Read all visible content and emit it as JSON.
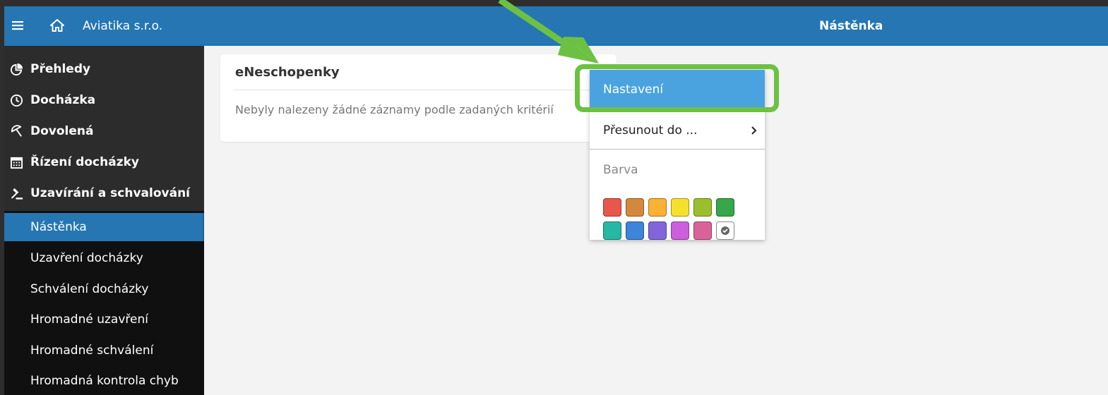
{
  "header": {
    "company": "Aviatika s.r.o.",
    "page_title": "Nástěnka"
  },
  "sidebar": {
    "main_items": [
      {
        "label": "Přehledy",
        "icon": "pie-chart-icon"
      },
      {
        "label": "Docházka",
        "icon": "clock-icon"
      },
      {
        "label": "Dovolená",
        "icon": "beach-umbrella-icon"
      },
      {
        "label": "Řízení docházky",
        "icon": "calendar-icon"
      },
      {
        "label": "Uzavírání a schvalování",
        "icon": "gavel-icon"
      }
    ],
    "sub_items": [
      {
        "label": "Nástěnka",
        "active": true
      },
      {
        "label": "Uzavření docházky"
      },
      {
        "label": "Schválení docházky"
      },
      {
        "label": "Hromadné uzavření"
      },
      {
        "label": "Hromadné schválení"
      },
      {
        "label": "Hromadná kontrola chyb"
      }
    ]
  },
  "card": {
    "title": "eNeschopenky",
    "empty_message": "Nebyly nalezeny žádné záznamy podle zadaných kritérií"
  },
  "context_menu": {
    "settings": "Nastavení",
    "move_to": "Přesunout do ...",
    "color_label": "Barva",
    "colors": [
      "#e8574a",
      "#d4883e",
      "#f9b233",
      "#f5e12c",
      "#9bbf2c",
      "#38a64b",
      "#26b8a3",
      "#3d85d8",
      "#8266d9",
      "#cb5fdc",
      "#d96398",
      "none"
    ]
  },
  "theme": {
    "header_bg": "#2576b3",
    "active_item_bg": "#2576b3",
    "menu_highlight": "#4aa3df",
    "callout_green": "#6cc143"
  }
}
